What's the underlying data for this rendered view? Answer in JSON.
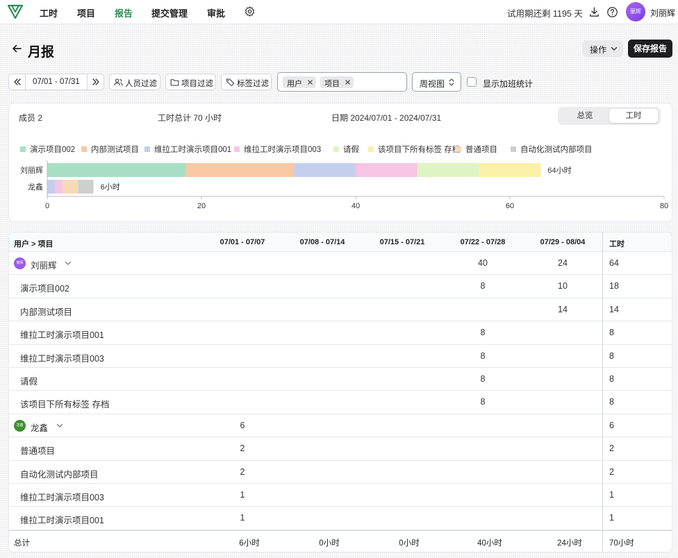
{
  "nav": {
    "items": [
      {
        "label": "工时",
        "active": false
      },
      {
        "label": "项目",
        "active": false
      },
      {
        "label": "报告",
        "active": true
      },
      {
        "label": "提交管理",
        "active": false
      },
      {
        "label": "审批",
        "active": false
      }
    ],
    "settings_icon": "gear-icon",
    "trial_text": "试用期还剩 1195 天",
    "download_icon": "download-icon",
    "help_icon": "help-icon",
    "avatar_text": "丽辉",
    "user_name": "刘丽辉"
  },
  "page": {
    "title": "月报",
    "ops_label": "操作",
    "save_label": "保存报告"
  },
  "filters": {
    "date_range": "07/01 - 07/31",
    "people_filter": "人员过滤",
    "project_filter": "项目过滤",
    "tag_filter": "标签过滤",
    "group_chips": [
      "用户",
      "项目"
    ],
    "view_select": "周视图",
    "overtime_label": "显示加班统计",
    "overtime_checked": false
  },
  "summary": {
    "members": "成员 2",
    "total_hours": "工时总计 70 小时",
    "date": "日期 2024/07/01 - 2024/07/31",
    "switch_overview": "总览",
    "switch_hours": "工时",
    "switch_selected": "工时"
  },
  "colors": {
    "accent": "#2e8b57",
    "avatar_1": "#9b59e8",
    "avatar_2": "#3f8f2f"
  },
  "chart_data": {
    "type": "bar",
    "orientation": "horizontal",
    "stacked": true,
    "categories": [
      "刘丽辉",
      "龙鑫"
    ],
    "series": [
      {
        "name": "演示项目002",
        "color": "#a8dfc4",
        "values": [
          18,
          0
        ]
      },
      {
        "name": "内部测试项目",
        "color": "#f9c9a3",
        "values": [
          14,
          0
        ]
      },
      {
        "name": "维拉工时演示项目001",
        "color": "#c4cfee",
        "values": [
          8,
          1
        ]
      },
      {
        "name": "维拉工时演示项目003",
        "color": "#f6c4e4",
        "values": [
          8,
          1
        ]
      },
      {
        "name": "请假",
        "color": "#dff4c4",
        "values": [
          8,
          0
        ]
      },
      {
        "name": "该项目下所有标签 存档",
        "color": "#fbf1a6",
        "values": [
          8,
          0
        ]
      },
      {
        "name": "普通项目",
        "color": "#f8d9b6",
        "values": [
          0,
          2
        ]
      },
      {
        "name": "自动化测试内部项目",
        "color": "#cfcfcf",
        "values": [
          0,
          2
        ]
      }
    ],
    "bar_labels": [
      "64小时",
      "6小时"
    ],
    "xlim": [
      0,
      80
    ],
    "xticks": [
      0,
      20,
      40,
      60,
      80
    ],
    "xlabel": "",
    "ylabel": "",
    "legend": "top",
    "grid": false
  },
  "table": {
    "headers": [
      "用户 > 项目",
      "07/01 - 07/07",
      "07/08 - 07/14",
      "07/15 - 07/21",
      "07/22 - 07/28",
      "07/29 - 08/04",
      "工时"
    ],
    "rows": [
      {
        "kind": "user",
        "label": "刘丽辉",
        "avatar": "丽辉",
        "avatar_color": "#9b59e8",
        "cells": [
          "",
          "",
          "",
          "40",
          "24"
        ],
        "total": "64"
      },
      {
        "kind": "project",
        "label": "演示项目002",
        "cells": [
          "",
          "",
          "",
          "8",
          "10"
        ],
        "total": "18"
      },
      {
        "kind": "project",
        "label": "内部测试项目",
        "cells": [
          "",
          "",
          "",
          "",
          "14"
        ],
        "total": "14"
      },
      {
        "kind": "project",
        "label": "维拉工时演示项目001",
        "cells": [
          "",
          "",
          "",
          "8",
          ""
        ],
        "total": "8"
      },
      {
        "kind": "project",
        "label": "维拉工时演示项目003",
        "cells": [
          "",
          "",
          "",
          "8",
          ""
        ],
        "total": "8"
      },
      {
        "kind": "project",
        "label": "请假",
        "cells": [
          "",
          "",
          "",
          "8",
          ""
        ],
        "total": "8"
      },
      {
        "kind": "project",
        "label": "该项目下所有标签 存档",
        "cells": [
          "",
          "",
          "",
          "8",
          ""
        ],
        "total": "8"
      },
      {
        "kind": "user",
        "label": "龙鑫",
        "avatar": "龙鑫",
        "avatar_color": "#3f8f2f",
        "cells": [
          "6",
          "",
          "",
          "",
          ""
        ],
        "total": "6"
      },
      {
        "kind": "project",
        "label": "普通项目",
        "cells": [
          "2",
          "",
          "",
          "",
          ""
        ],
        "total": "2"
      },
      {
        "kind": "project",
        "label": "自动化测试内部项目",
        "cells": [
          "2",
          "",
          "",
          "",
          ""
        ],
        "total": "2"
      },
      {
        "kind": "project",
        "label": "维拉工时演示项目003",
        "cells": [
          "1",
          "",
          "",
          "",
          ""
        ],
        "total": "1"
      },
      {
        "kind": "project",
        "label": "维拉工时演示项目001",
        "cells": [
          "1",
          "",
          "",
          "",
          ""
        ],
        "total": "1"
      }
    ],
    "footer": {
      "label": "总计",
      "cells": [
        "6小时",
        "0小时",
        "0小时",
        "40小时",
        "24小时"
      ],
      "total": "70小时"
    }
  }
}
